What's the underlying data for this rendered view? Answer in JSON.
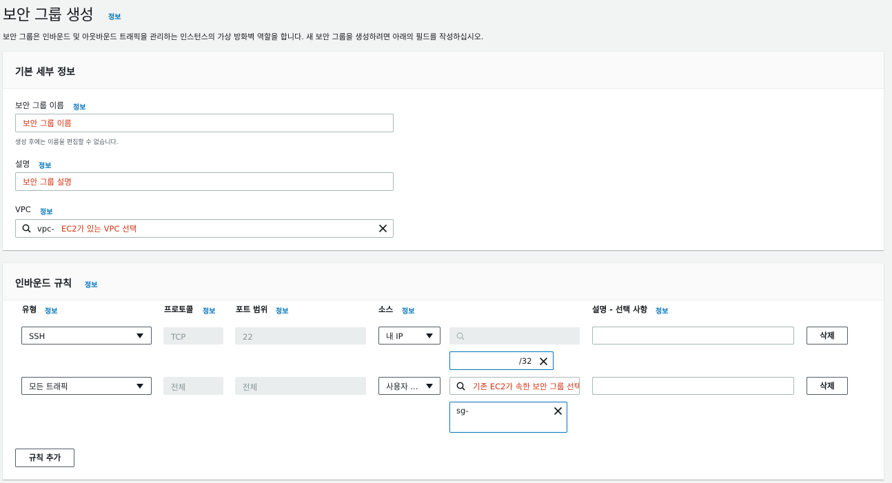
{
  "header": {
    "title": "보안 그룹 생성",
    "title_info": "정보",
    "description": "보안 그룹은 인바운드 및 아웃바운드 트래픽을 관리하는 인스턴스의 가상 방화벽 역할을 합니다. 새 보안 그룹을 생성하려면 아래의 필드를 작성하십시오."
  },
  "basic": {
    "heading": "기본 세부 정보",
    "name_label": "보안 그룹 이름",
    "name_info": "정보",
    "name_value": "보안 그룹 이름",
    "name_hint": "생성 후에는 이름을 편집할 수 없습니다.",
    "desc_label": "설명",
    "desc_info": "정보",
    "desc_value": "보안 그룹 설명",
    "vpc_label": "VPC",
    "vpc_info": "정보",
    "vpc_prefix": "vpc-",
    "vpc_value": "EC2가 있는 VPC 선택"
  },
  "inbound": {
    "heading": "인바운드 규칙",
    "heading_info": "정보",
    "columns": {
      "type": "유형",
      "protocol": "프로토콜",
      "port": "포트 범위",
      "source": "소스",
      "description": "설명 - 선택 사항",
      "info": "정보"
    },
    "rows": [
      {
        "type": "SSH",
        "protocol": "TCP",
        "port": "22",
        "source": "내 IP",
        "search_value": "",
        "token": "/32",
        "description": "",
        "delete": "삭제"
      },
      {
        "type": "모든 트래픽",
        "protocol": "전체",
        "port": "전체",
        "source": "사용자 ...",
        "search_value": "기존 EC2가 속한 보안 그룹 선택",
        "token": "sg-",
        "description": "",
        "delete": "삭제"
      }
    ],
    "add_rule": "규칙 추가"
  }
}
